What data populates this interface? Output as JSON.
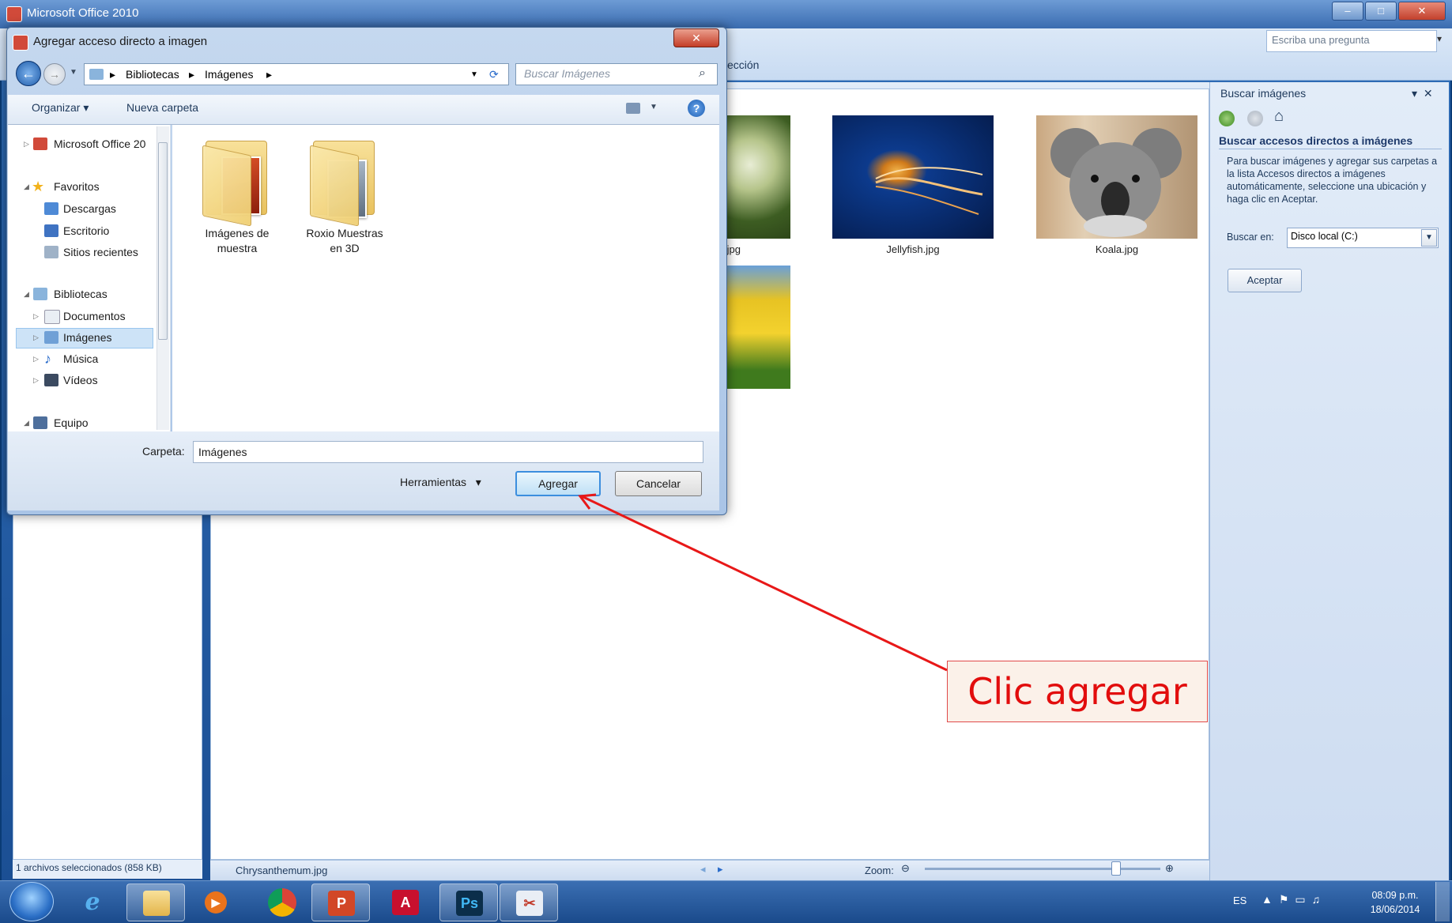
{
  "main_window": {
    "title": "Microsoft Office 2010",
    "ask_placeholder": "Escriba una pregunta",
    "ribbon_fragment": "ección",
    "left_status": "1 archivos seleccionados (858 KB)",
    "status_filename": "Chrysanthemum.jpg",
    "zoom_label": "Zoom:",
    "thumbnails": [
      {
        "caption": ".jpg"
      },
      {
        "caption": "Jellyfish.jpg"
      },
      {
        "caption": "Koala.jpg"
      },
      {
        "caption": ""
      }
    ]
  },
  "task_pane": {
    "title": "Buscar imágenes",
    "heading": "Buscar accesos directos a imágenes",
    "description": "Para buscar imágenes y agregar sus carpetas a la lista Accesos directos a imágenes automáticamente, seleccione una ubicación y haga clic en Aceptar.",
    "search_in_label": "Buscar en:",
    "search_in_value": "Disco local (C:)",
    "accept_label": "Aceptar"
  },
  "dialog": {
    "title": "Agregar acceso directo a imagen",
    "breadcrumb": [
      "Bibliotecas",
      "Imágenes"
    ],
    "search_placeholder": "Buscar Imágenes",
    "organize_label": "Organizar",
    "new_folder_label": "Nueva carpeta",
    "nav": {
      "items": [
        {
          "label": "Microsoft Office 20"
        },
        {
          "label": "Favoritos"
        },
        {
          "label": "Descargas"
        },
        {
          "label": "Escritorio"
        },
        {
          "label": "Sitios recientes"
        },
        {
          "label": "Bibliotecas"
        },
        {
          "label": "Documentos"
        },
        {
          "label": "Imágenes"
        },
        {
          "label": "Música"
        },
        {
          "label": "Vídeos"
        },
        {
          "label": "Equipo"
        }
      ]
    },
    "folders": [
      {
        "line1": "Imágenes de",
        "line2": "muestra"
      },
      {
        "line1": "Roxio Muestras",
        "line2": "en 3D"
      }
    ],
    "folder_label": "Carpeta:",
    "folder_value": "Imágenes",
    "tools_label": "Herramientas",
    "add_label": "Agregar",
    "cancel_label": "Cancelar"
  },
  "annotation": {
    "text": "Clic agregar",
    "color": "#e20d0d"
  },
  "taskbar": {
    "lang": "ES",
    "time": "08:09 p.m.",
    "date": "18/06/2014",
    "apps": [
      {
        "icon": "internet-explorer-icon",
        "glyph": "e"
      },
      {
        "icon": "explorer-icon",
        "glyph": ""
      },
      {
        "icon": "media-player-icon",
        "glyph": "▶"
      },
      {
        "icon": "chrome-icon",
        "glyph": ""
      },
      {
        "icon": "powerpoint-icon",
        "glyph": "P"
      },
      {
        "icon": "acrobat-icon",
        "glyph": "A"
      },
      {
        "icon": "photoshop-icon",
        "glyph": "Ps"
      },
      {
        "icon": "office-picture-icon",
        "glyph": "✂"
      }
    ]
  }
}
